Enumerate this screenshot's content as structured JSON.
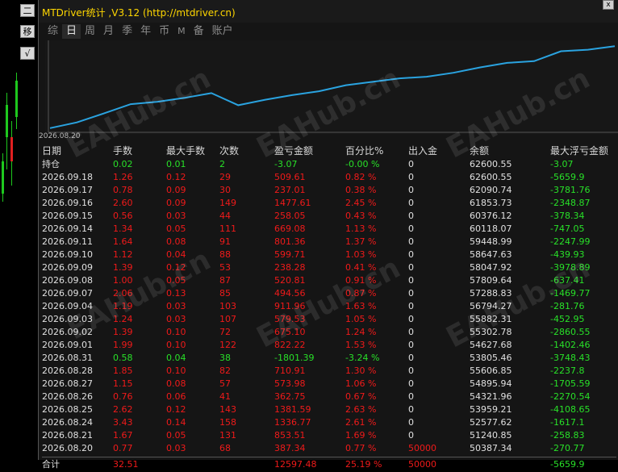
{
  "toolbar": {
    "btn1": "二",
    "btn2": "移",
    "btn3": "√"
  },
  "window": {
    "title": "MTDriver统计 ,V3.12 (http://mtdriver.cn)",
    "close": "x"
  },
  "tabs": [
    {
      "label": "综",
      "active": false
    },
    {
      "label": "日",
      "active": true
    },
    {
      "label": "周",
      "active": false
    },
    {
      "label": "月",
      "active": false
    },
    {
      "label": "季",
      "active": false
    },
    {
      "label": "年",
      "active": false
    },
    {
      "label": "币",
      "active": false
    },
    {
      "label": "M",
      "active": false
    },
    {
      "label": "备",
      "active": false
    },
    {
      "label": "账户",
      "active": false
    }
  ],
  "chart": {
    "start_date": "2026.08.20",
    "line_color": "#2aa3e0"
  },
  "watermark": "EAHub.cn",
  "headers": [
    "日期",
    "手数",
    "最大手数",
    "次数",
    "盈亏金额",
    "百分比%",
    "出入金",
    "余额",
    "最大浮亏金额"
  ],
  "rows": [
    {
      "d": "持仓",
      "lots": "0.02",
      "max": "0.01",
      "cnt": "2",
      "pl": "-3.07",
      "pct": "-0.00 %",
      "io": "0",
      "bal": "62600.55",
      "dd": "-3.07",
      "pos": true
    },
    {
      "d": "2026.09.18",
      "lots": "1.26",
      "max": "0.12",
      "cnt": "29",
      "pl": "509.61",
      "pct": "0.82 %",
      "io": "0",
      "bal": "62600.55",
      "dd": "-5659.9"
    },
    {
      "d": "2026.09.17",
      "lots": "0.78",
      "max": "0.09",
      "cnt": "30",
      "pl": "237.01",
      "pct": "0.38 %",
      "io": "0",
      "bal": "62090.74",
      "dd": "-3781.76"
    },
    {
      "d": "2026.09.16",
      "lots": "2.60",
      "max": "0.09",
      "cnt": "149",
      "pl": "1477.61",
      "pct": "2.45 %",
      "io": "0",
      "bal": "61853.73",
      "dd": "-2348.87"
    },
    {
      "d": "2026.09.15",
      "lots": "0.56",
      "max": "0.03",
      "cnt": "44",
      "pl": "258.05",
      "pct": "0.43 %",
      "io": "0",
      "bal": "60376.12",
      "dd": "-378.34"
    },
    {
      "d": "2026.09.14",
      "lots": "1.34",
      "max": "0.05",
      "cnt": "111",
      "pl": "669.08",
      "pct": "1.13 %",
      "io": "0",
      "bal": "60118.07",
      "dd": "-747.05"
    },
    {
      "d": "2026.09.11",
      "lots": "1.64",
      "max": "0.08",
      "cnt": "91",
      "pl": "801.36",
      "pct": "1.37 %",
      "io": "0",
      "bal": "59448.99",
      "dd": "-2247.99"
    },
    {
      "d": "2026.09.10",
      "lots": "1.12",
      "max": "0.04",
      "cnt": "88",
      "pl": "599.71",
      "pct": "1.03 %",
      "io": "0",
      "bal": "58647.63",
      "dd": "-439.93"
    },
    {
      "d": "2026.09.09",
      "lots": "1.39",
      "max": "0.12",
      "cnt": "53",
      "pl": "238.28",
      "pct": "0.41 %",
      "io": "0",
      "bal": "58047.92",
      "dd": "-3978.89"
    },
    {
      "d": "2026.09.08",
      "lots": "1.00",
      "max": "0.05",
      "cnt": "87",
      "pl": "520.81",
      "pct": "0.91 %",
      "io": "0",
      "bal": "57809.64",
      "dd": "-637.41"
    },
    {
      "d": "2026.09.07",
      "lots": "2.06",
      "max": "0.13",
      "cnt": "85",
      "pl": "494.56",
      "pct": "0.87 %",
      "io": "0",
      "bal": "57288.83",
      "dd": "-1469.77"
    },
    {
      "d": "2026.09.04",
      "lots": "1.19",
      "max": "0.03",
      "cnt": "103",
      "pl": "911.96",
      "pct": "1.63 %",
      "io": "0",
      "bal": "56794.27",
      "dd": "-281.76"
    },
    {
      "d": "2026.09.03",
      "lots": "1.24",
      "max": "0.03",
      "cnt": "107",
      "pl": "579.53",
      "pct": "1.05 %",
      "io": "0",
      "bal": "55882.31",
      "dd": "-452.95"
    },
    {
      "d": "2026.09.02",
      "lots": "1.39",
      "max": "0.10",
      "cnt": "72",
      "pl": "675.10",
      "pct": "1.24 %",
      "io": "0",
      "bal": "55302.78",
      "dd": "-2860.55"
    },
    {
      "d": "2026.09.01",
      "lots": "1.99",
      "max": "0.10",
      "cnt": "122",
      "pl": "822.22",
      "pct": "1.53 %",
      "io": "0",
      "bal": "54627.68",
      "dd": "-1402.46"
    },
    {
      "d": "2026.08.31",
      "lots": "0.58",
      "max": "0.04",
      "cnt": "38",
      "pl": "-1801.39",
      "pct": "-3.24 %",
      "io": "0",
      "bal": "53805.46",
      "dd": "-3748.43",
      "pos": true
    },
    {
      "d": "2026.08.28",
      "lots": "1.85",
      "max": "0.10",
      "cnt": "82",
      "pl": "710.91",
      "pct": "1.30 %",
      "io": "0",
      "bal": "55606.85",
      "dd": "-2237.8"
    },
    {
      "d": "2026.08.27",
      "lots": "1.15",
      "max": "0.08",
      "cnt": "57",
      "pl": "573.98",
      "pct": "1.06 %",
      "io": "0",
      "bal": "54895.94",
      "dd": "-1705.59"
    },
    {
      "d": "2026.08.26",
      "lots": "0.76",
      "max": "0.06",
      "cnt": "41",
      "pl": "362.75",
      "pct": "0.67 %",
      "io": "0",
      "bal": "54321.96",
      "dd": "-2270.54"
    },
    {
      "d": "2026.08.25",
      "lots": "2.62",
      "max": "0.12",
      "cnt": "143",
      "pl": "1381.59",
      "pct": "2.63 %",
      "io": "0",
      "bal": "53959.21",
      "dd": "-4108.65"
    },
    {
      "d": "2026.08.24",
      "lots": "3.43",
      "max": "0.14",
      "cnt": "158",
      "pl": "1336.77",
      "pct": "2.61 %",
      "io": "0",
      "bal": "52577.62",
      "dd": "-1617.1"
    },
    {
      "d": "2026.08.21",
      "lots": "1.67",
      "max": "0.05",
      "cnt": "131",
      "pl": "853.51",
      "pct": "1.69 %",
      "io": "0",
      "bal": "51240.85",
      "dd": "-258.83"
    },
    {
      "d": "2026.08.20",
      "lots": "0.77",
      "max": "0.03",
      "cnt": "68",
      "pl": "387.34",
      "pct": "0.77 %",
      "io": "50000",
      "bal": "50387.34",
      "dd": "-270.77"
    }
  ],
  "total": {
    "d": "合计",
    "lots": "32.51",
    "max": "",
    "cnt": "",
    "pl": "12597.48",
    "pct": "25.19 %",
    "io": "50000",
    "bal": "",
    "dd": "-5659.9"
  }
}
